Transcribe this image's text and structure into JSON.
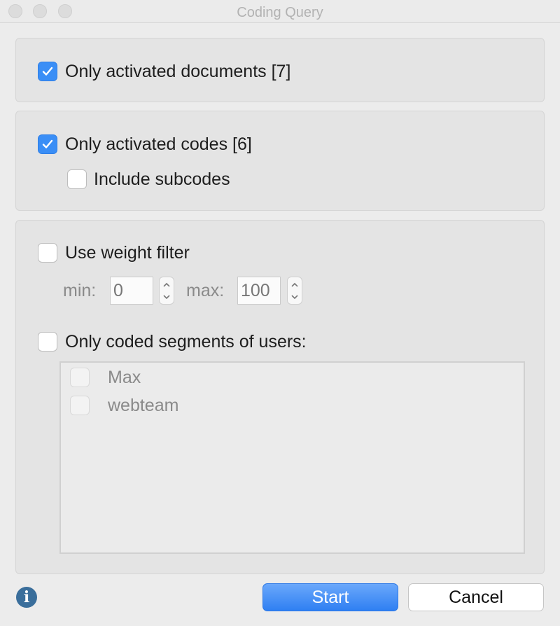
{
  "window": {
    "title": "Coding Query"
  },
  "documents_panel": {
    "only_activated_documents": {
      "label": "Only activated documents [7]",
      "checked": true
    }
  },
  "codes_panel": {
    "only_activated_codes": {
      "label": "Only activated codes [6]",
      "checked": true
    },
    "include_subcodes": {
      "label": "Include subcodes",
      "checked": false
    }
  },
  "filters_panel": {
    "use_weight_filter": {
      "label": "Use weight filter",
      "checked": false
    },
    "min_label": "min:",
    "min_value": "0",
    "max_label": "max:",
    "max_value": "100",
    "only_coded_segments": {
      "label": "Only coded segments of users:",
      "checked": false
    },
    "users": [
      {
        "name": "Max",
        "checked": false
      },
      {
        "name": "webteam",
        "checked": false
      }
    ]
  },
  "footer": {
    "info_icon": "info-icon",
    "info_glyph": "i",
    "start_label": "Start",
    "cancel_label": "Cancel"
  },
  "colors": {
    "accent": "#3a8ef6",
    "info": "#3a6e9b"
  }
}
